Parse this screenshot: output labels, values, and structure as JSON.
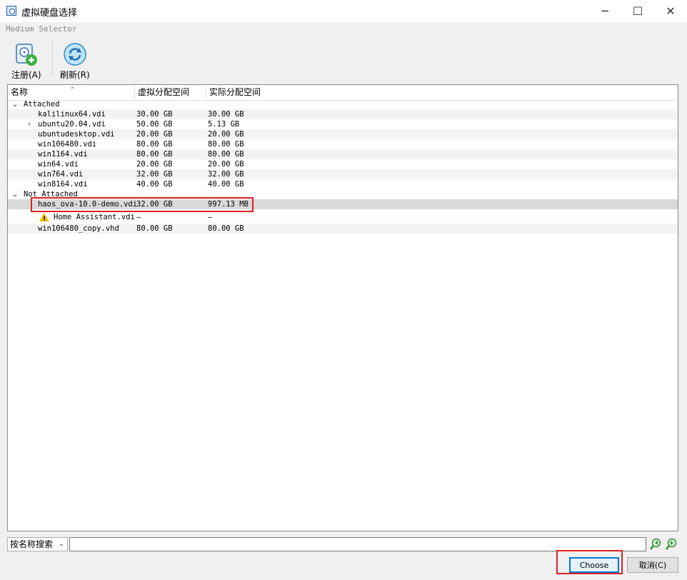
{
  "window": {
    "title": "虚拟硬盘选择",
    "subtitle": "Medium Selector",
    "minimize_glyph": "─",
    "maximize_glyph": "☐",
    "close_glyph": "✕"
  },
  "toolbar": {
    "register_label": "注册(A)",
    "refresh_label": "刷新(R)"
  },
  "tree": {
    "columns": [
      "名称",
      "虚拟分配空间",
      "实际分配空间"
    ],
    "groups": [
      {
        "label": "Attached",
        "rows": [
          {
            "name": "kalilinux64.vdi",
            "virtual": "30.00 GB",
            "actual": "30.00 GB"
          },
          {
            "name": "ubuntu20.04.vdi",
            "virtual": "50.00 GB",
            "actual": "5.13 GB",
            "expandable": true
          },
          {
            "name": "ubuntudesktop.vdi",
            "virtual": "20.00 GB",
            "actual": "20.00 GB"
          },
          {
            "name": "win106480.vdi",
            "virtual": "80.00 GB",
            "actual": "80.00 GB"
          },
          {
            "name": "win1164.vdi",
            "virtual": "80.00 GB",
            "actual": "80.00 GB"
          },
          {
            "name": "win64.vdi",
            "virtual": "20.00 GB",
            "actual": "20.00 GB"
          },
          {
            "name": "win764.vdi",
            "virtual": "32.00 GB",
            "actual": "32.00 GB"
          },
          {
            "name": "win8164.vdi",
            "virtual": "40.00 GB",
            "actual": "40.00 GB"
          }
        ]
      },
      {
        "label": "Not Attached",
        "rows": [
          {
            "name": "haos_ova-10.0-demo.vdi",
            "virtual": "32.00 GB",
            "actual": "997.13 MB",
            "selected": true
          },
          {
            "name": "Home Assistant.vdi",
            "virtual": "—",
            "actual": "—",
            "warning": true
          },
          {
            "name": "win106480_copy.vhd",
            "virtual": "80.00 GB",
            "actual": "80.00 GB"
          }
        ]
      }
    ]
  },
  "search": {
    "mode": "按名称搜索",
    "value": ""
  },
  "buttons": {
    "choose": "Choose",
    "cancel": "取消(C)"
  },
  "colors": {
    "highlight": "#e02020",
    "accent": "#0078d7"
  }
}
